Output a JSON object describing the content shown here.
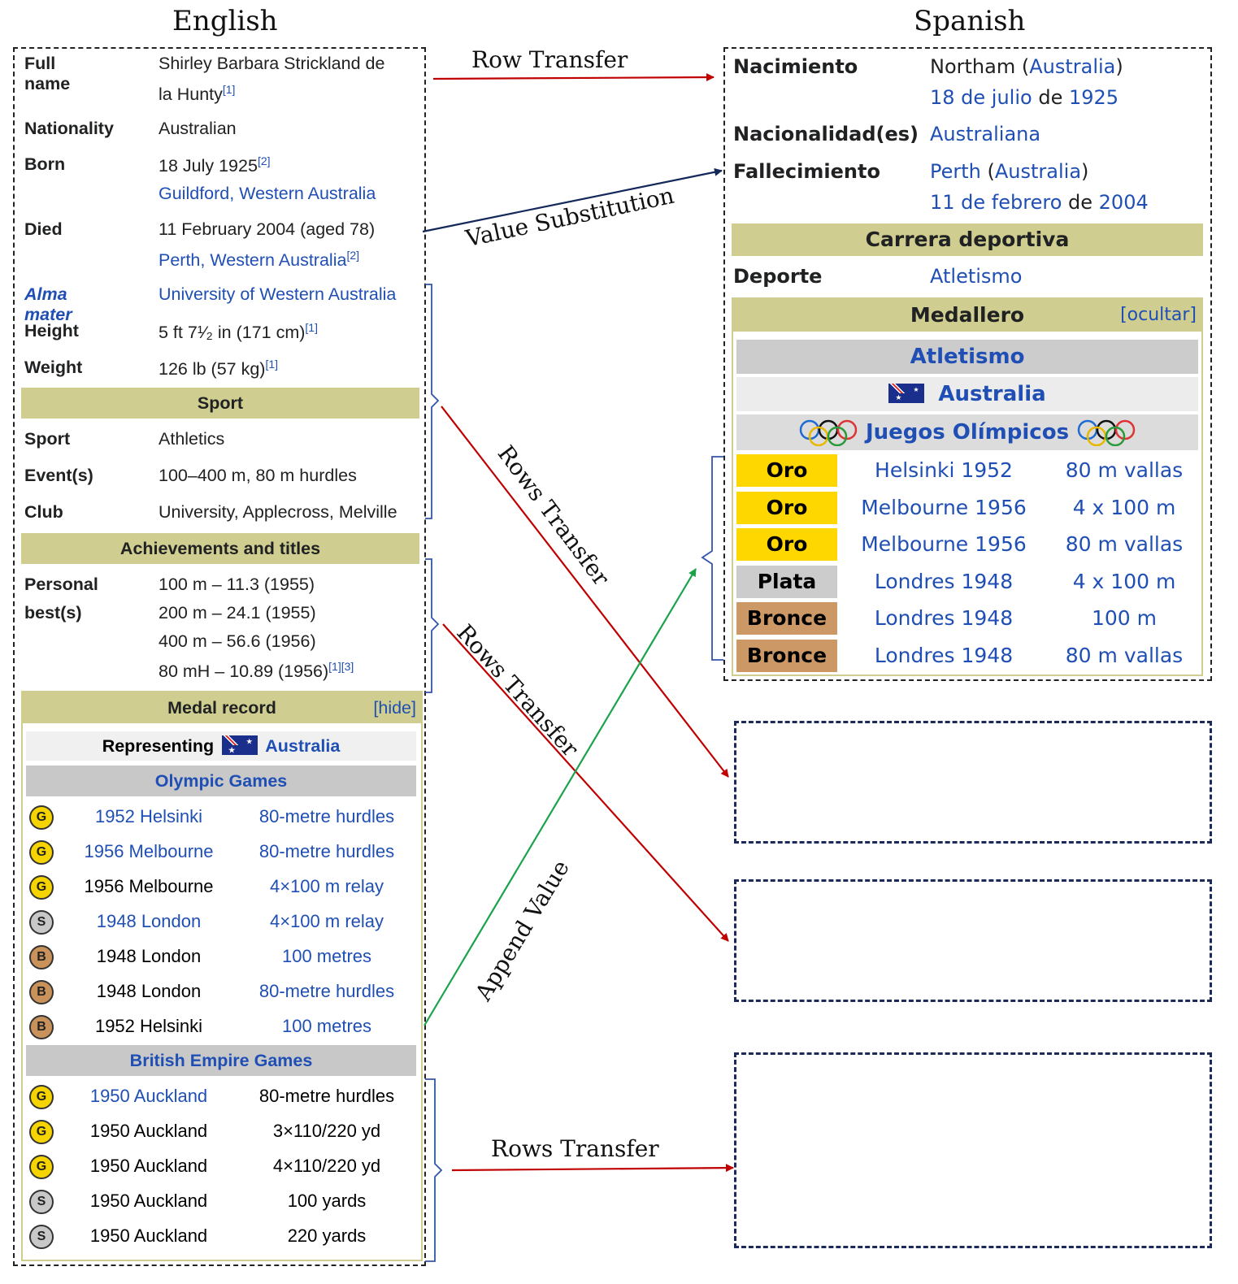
{
  "headers": {
    "left": "English",
    "right": "Spanish"
  },
  "english": {
    "rows": [
      {
        "label": "Full name",
        "line1": "Shirley Barbara Strickland de",
        "line2": "la Hunty",
        "ref": "[1]"
      },
      {
        "label": "Nationality",
        "value": "Australian"
      },
      {
        "label": "Born",
        "line1": "18 July 1925",
        "ref1": "[2]",
        "line2": "Guildford, Western Australia"
      },
      {
        "label": "Died",
        "line1": "11 February 2004 (aged 78)",
        "line2": "Perth, Western Australia",
        "ref2": "[2]"
      },
      {
        "label": "Alma mater",
        "value": "University of Western Australia"
      },
      {
        "label": "Height",
        "value": "5 ft 7¹⁄₂ in (171 cm)",
        "ref": "[1]"
      },
      {
        "label": "Weight",
        "value": "126 lb (57 kg)",
        "ref": "[1]"
      }
    ],
    "sport_section": "Sport",
    "sport_rows": [
      {
        "label": "Sport",
        "value": "Athletics"
      },
      {
        "label": "Event(s)",
        "value": "100–400 m, 80 m hurdles"
      },
      {
        "label": "Club",
        "value": "University, Applecross, Melville"
      }
    ],
    "achievements_section": "Achievements and titles",
    "pb_label1": "Personal",
    "pb_label2": "best(s)",
    "pb_values": [
      "100 m – 11.3 (1955)",
      "200 m – 24.1 (1955)",
      "400 m – 56.6 (1956)",
      "80 mH – 10.89 (1956)"
    ],
    "pb_refs": "[1][3]",
    "medal_record": "Medal record",
    "hide": "[hide]",
    "representing": "Representing",
    "country": "Australia",
    "olympic_games": "Olympic Games",
    "olympic_medals": [
      {
        "medal": "G",
        "type": "gold",
        "games": "1952 Helsinki",
        "event": "80-metre hurdles",
        "games_link": true,
        "event_link": true
      },
      {
        "medal": "G",
        "type": "gold",
        "games": "1956 Melbourne",
        "event": "80-metre hurdles",
        "games_link": true,
        "event_link": true
      },
      {
        "medal": "G",
        "type": "gold",
        "games": "1956 Melbourne",
        "event": "4×100 m relay",
        "games_link": false,
        "event_link": true
      },
      {
        "medal": "S",
        "type": "silver",
        "games": "1948 London",
        "event": "4×100 m relay",
        "games_link": true,
        "event_link": true
      },
      {
        "medal": "B",
        "type": "bronze",
        "games": "1948 London",
        "event": "100 metres",
        "games_link": false,
        "event_link": true
      },
      {
        "medal": "B",
        "type": "bronze",
        "games": "1948 London",
        "event": "80-metre hurdles",
        "games_link": false,
        "event_link": true
      },
      {
        "medal": "B",
        "type": "bronze",
        "games": "1952 Helsinki",
        "event": "100 metres",
        "games_link": false,
        "event_link": true
      }
    ],
    "british_empire_games": "British Empire Games",
    "beg_medals": [
      {
        "medal": "G",
        "type": "gold",
        "games": "1950 Auckland",
        "event": "80-metre hurdles",
        "games_link": true,
        "event_link": false
      },
      {
        "medal": "G",
        "type": "gold",
        "games": "1950 Auckland",
        "event": "3×110/220 yd",
        "games_link": false,
        "event_link": false
      },
      {
        "medal": "G",
        "type": "gold",
        "games": "1950 Auckland",
        "event": "4×110/220 yd",
        "games_link": false,
        "event_link": false
      },
      {
        "medal": "S",
        "type": "silver",
        "games": "1950 Auckland",
        "event": "100 yards",
        "games_link": false,
        "event_link": false
      },
      {
        "medal": "S",
        "type": "silver",
        "games": "1950 Auckland",
        "event": "220 yards",
        "games_link": false,
        "event_link": false
      }
    ]
  },
  "spanish": {
    "nacimiento_label": "Nacimiento",
    "nacimiento_place": "Northam",
    "nacimiento_country": "Australia",
    "nacimiento_day": "18 de julio",
    "nacimiento_de": "de",
    "nacimiento_year": "1925",
    "nacionalidad_label": "Nacionalidad(es)",
    "nacionalidad_value": "Australiana",
    "fallecimiento_label": "Fallecimiento",
    "fallecimiento_place": "Perth",
    "fallecimiento_country": "Australia",
    "fallecimiento_day": "11 de febrero",
    "fallecimiento_de": "de",
    "fallecimiento_year": "2004",
    "carrera": "Carrera deportiva",
    "deporte_label": "Deporte",
    "deporte_value": "Atletismo",
    "medallero": "Medallero",
    "ocultar": "[ocultar]",
    "atletismo": "Atletismo",
    "country": "Australia",
    "juegos": "Juegos Olímpicos",
    "medals": [
      {
        "medal": "Oro",
        "type": "gold",
        "games": "Helsinki 1952",
        "event": "80 m vallas"
      },
      {
        "medal": "Oro",
        "type": "gold",
        "games": "Melbourne 1956",
        "event": "4 x 100 m"
      },
      {
        "medal": "Oro",
        "type": "gold",
        "games": "Melbourne 1956",
        "event": "80 m vallas"
      },
      {
        "medal": "Plata",
        "type": "silver",
        "games": "Londres 1948",
        "event": "4 x 100 m"
      },
      {
        "medal": "Bronce",
        "type": "bronze",
        "games": "Londres 1948",
        "event": "100 m"
      },
      {
        "medal": "Bronce",
        "type": "bronze",
        "games": "Londres 1948",
        "event": "80 m vallas"
      }
    ]
  },
  "arrows": {
    "row_transfer": "Row Transfer",
    "value_substitution": "Value Substitution",
    "rows_transfer_1": "Rows Transfer",
    "rows_transfer_2": "Rows Transfer",
    "append_value": "Append Value",
    "rows_transfer_3": "Rows Transfer"
  },
  "colors": {
    "link": "#1f4fb4",
    "section_band": "#cfcd8f",
    "arrow_red": "#c00000",
    "arrow_navy": "#14285a",
    "arrow_green": "#1aa34a",
    "gold": "#f5d400",
    "silver": "#c8c8c8",
    "bronze": "#c8925a"
  }
}
